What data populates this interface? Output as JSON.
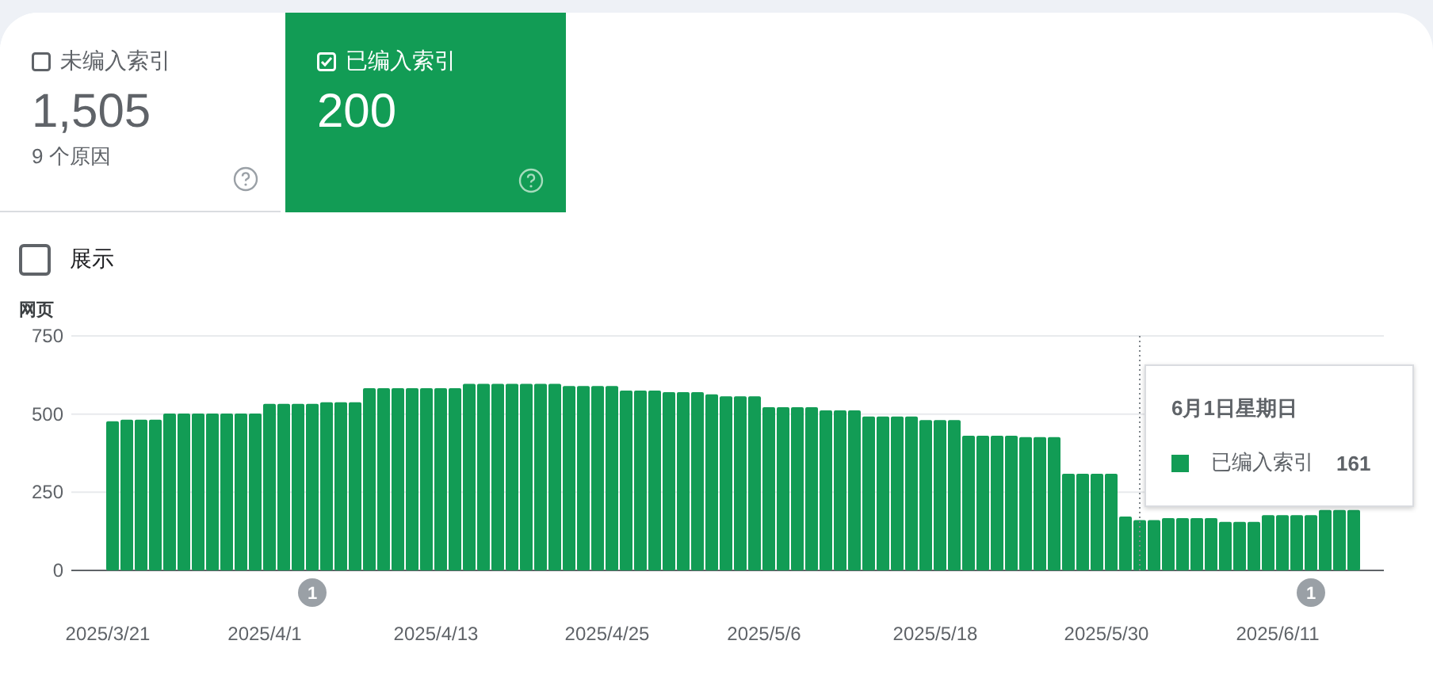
{
  "tabs": [
    {
      "label": "未编入索引",
      "count": "1,505",
      "sub": "9 个原因",
      "selected": false,
      "checked": false
    },
    {
      "label": "已编入索引",
      "count": "200",
      "selected": true,
      "checked": true
    }
  ],
  "show_option": {
    "label": "展示",
    "checked": false
  },
  "chart": {
    "chart_data": {
      "type": "bar",
      "ylabel": "网页",
      "ylim": [
        0,
        750
      ],
      "yticks": [
        0,
        250,
        500,
        750
      ],
      "series": [
        {
          "name": "已编入索引",
          "color": "#129c55",
          "values": [
            477,
            482,
            482,
            482,
            502,
            502,
            502,
            502,
            502,
            502,
            502,
            533,
            533,
            533,
            533,
            538,
            538,
            538,
            583,
            583,
            583,
            583,
            583,
            583,
            583,
            597,
            597,
            597,
            597,
            597,
            597,
            597,
            590,
            590,
            590,
            590,
            575,
            575,
            575,
            570,
            570,
            570,
            563,
            557,
            557,
            557,
            522,
            522,
            522,
            522,
            512,
            512,
            512,
            492,
            492,
            492,
            492,
            481,
            481,
            481,
            431,
            431,
            431,
            431,
            426,
            426,
            426,
            309,
            309,
            309,
            309,
            172,
            161,
            161,
            167,
            167,
            167,
            167,
            155,
            155,
            155,
            177,
            177,
            177,
            177,
            193,
            193,
            193
          ]
        }
      ]
    },
    "x_axis_labels": [
      "2025/3/21",
      "2025/4/1",
      "2025/4/13",
      "2025/4/25",
      "2025/5/6",
      "2025/5/18",
      "2025/5/30",
      "2025/6/11"
    ],
    "markers": [
      {
        "label": "1"
      },
      {
        "label": "1"
      }
    ],
    "tooltip": {
      "title": "6月1日星期日",
      "value": "161"
    }
  }
}
